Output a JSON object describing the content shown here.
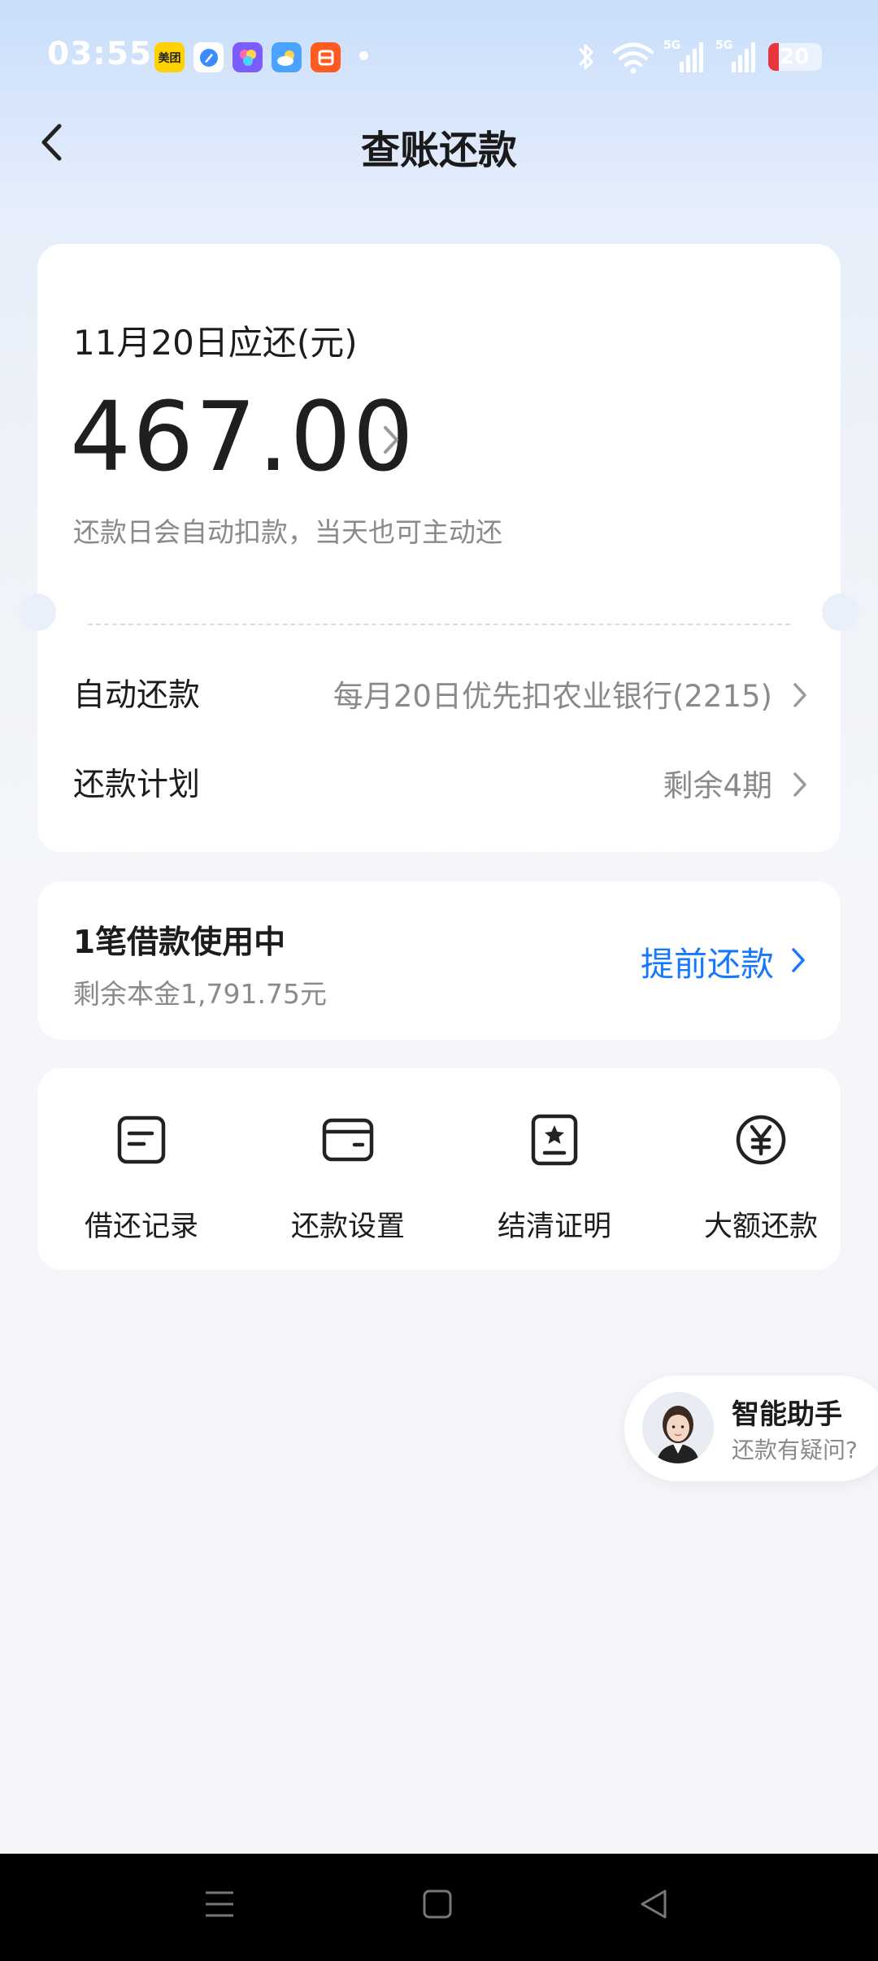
{
  "status_bar": {
    "time": "03:55",
    "notification_apps": [
      {
        "name": "meituan-app-icon",
        "label": "美团",
        "color": "#ffd100"
      },
      {
        "name": "browser-app-icon",
        "color": "#3a8bff"
      },
      {
        "name": "photos-app-icon",
        "color": "#7b5cff"
      },
      {
        "name": "weather-app-icon",
        "color": "#4aa3ff"
      },
      {
        "name": "taobao-app-icon",
        "color": "#ff5a1f"
      }
    ],
    "signal_label_1": "5G",
    "signal_label_2": "5G",
    "battery": "20"
  },
  "header": {
    "title": "查账还款"
  },
  "bill": {
    "due_label": "11月20日应还(元)",
    "amount": "467.00",
    "note": "还款日会自动扣款，当天也可主动还",
    "auto_repay_label": "自动还款",
    "auto_repay_value": "每月20日优先扣农业银行(2215)",
    "plan_label": "还款计划",
    "plan_value": "剩余4期"
  },
  "loan": {
    "title": "1笔借款使用中",
    "remaining": "剩余本金1,791.75元",
    "prepay_label": "提前还款"
  },
  "tools": [
    {
      "label": "借还记录",
      "icon": "record-icon"
    },
    {
      "label": "还款设置",
      "icon": "wallet-icon"
    },
    {
      "label": "结清证明",
      "icon": "certificate-icon"
    },
    {
      "label": "大额还款",
      "icon": "yuan-icon"
    }
  ],
  "assistant": {
    "title": "智能助手",
    "subtitle": "还款有疑问?"
  },
  "colors": {
    "accent": "#1677ff",
    "text": "#1c1c1e",
    "secondary": "#8a8a8e"
  }
}
